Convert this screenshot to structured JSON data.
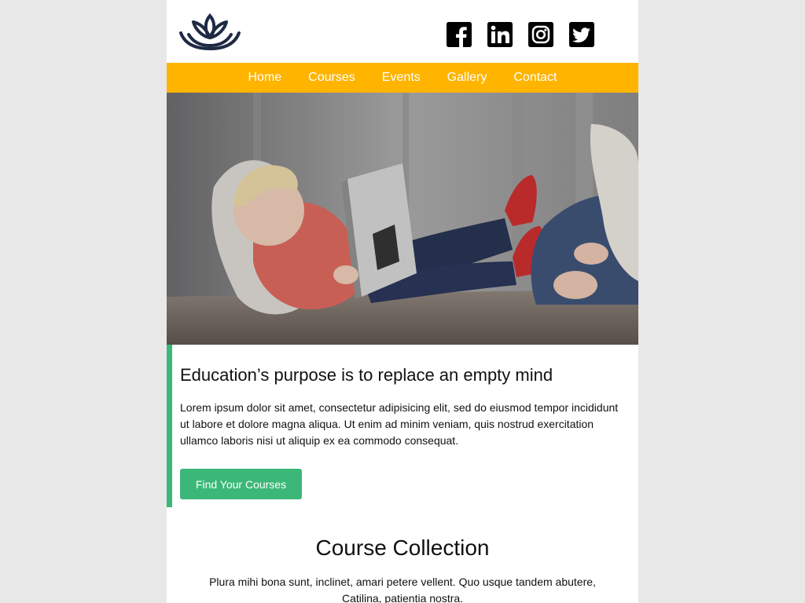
{
  "header": {
    "logo_icon": "lotus-icon",
    "brand_color": "#1e2a44",
    "social": [
      {
        "name": "facebook-icon"
      },
      {
        "name": "linkedin-icon"
      },
      {
        "name": "instagram-icon"
      },
      {
        "name": "twitter-icon"
      }
    ]
  },
  "nav": {
    "background": "#ffb400",
    "items": [
      {
        "label": "Home"
      },
      {
        "label": "Courses"
      },
      {
        "label": "Events"
      },
      {
        "label": "Gallery"
      },
      {
        "label": "Contact"
      }
    ]
  },
  "hero": {
    "image": "child-reading-book-photo"
  },
  "intro": {
    "accent": "#3bb878",
    "title": "Education’s purpose is to replace an empty mind",
    "body": "Lorem ipsum dolor sit amet, consectetur adipisicing elit, sed do eiusmod tempor incididunt ut labore et dolore magna aliqua. Ut enim ad minim veniam, quis nostrud exercitation ullamco laboris nisi ut aliquip ex ea commodo consequat.",
    "cta_label": "Find Your Courses"
  },
  "collection": {
    "title": "Course Collection",
    "description": "Plura mihi bona sunt, inclinet, amari petere vellent. Quo usque tandem abutere, Catilina, patientia nostra."
  }
}
